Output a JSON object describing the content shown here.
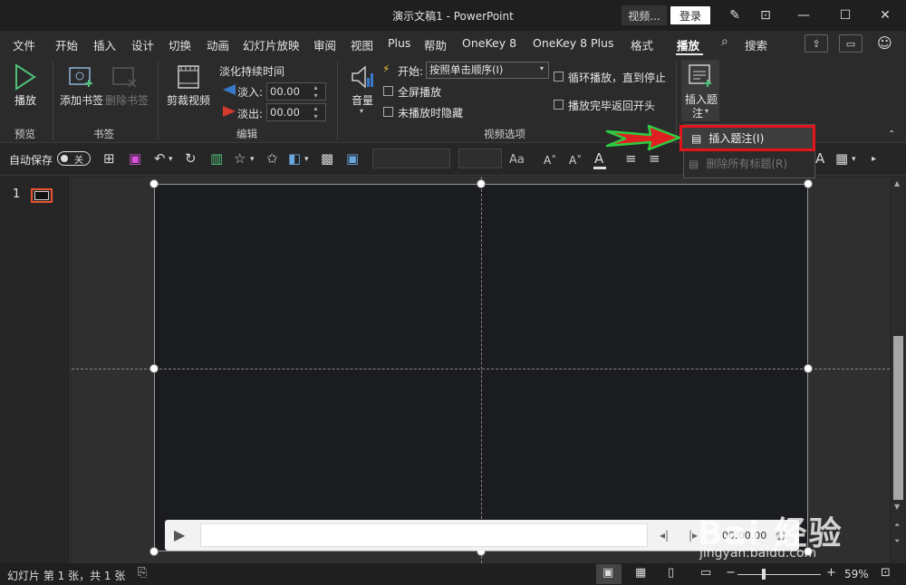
{
  "window": {
    "title": "演示文稿1  -  PowerPoint",
    "video_search": "视频...",
    "login": "登录"
  },
  "tabs": [
    "文件",
    "开始",
    "插入",
    "设计",
    "切换",
    "动画",
    "幻灯片放映",
    "审阅",
    "视图",
    "Plus",
    "帮助",
    "OneKey 8",
    "OneKey 8 Plus",
    "格式",
    "播放",
    "搜索"
  ],
  "active_tab": "播放",
  "ribbon": {
    "play_label": "播放",
    "add_bookmark": "添加书签",
    "remove_bookmark": "删除书签",
    "trim_video": "剪裁视频",
    "fade_duration": "淡化持续时间",
    "fade_in_label": "淡入:",
    "fade_in_value": "00.00",
    "fade_out_label": "淡出:",
    "fade_out_value": "00.00",
    "volume": "音量",
    "start_label": "开始:",
    "start_value": "按照单击顺序(I)",
    "fullscreen": "全屏播放",
    "hide_not_playing": "未播放时隐藏",
    "loop": "循环播放，直到停止",
    "rewind": "播放完毕返回开头",
    "insert_caption_line1": "插入题",
    "insert_caption_line2": "注",
    "groups": {
      "preview": "预览",
      "bookmarks": "书签",
      "editing": "编辑",
      "video_options": "视频选项"
    }
  },
  "qat": {
    "autosave_label": "自动保存",
    "autosave_state": "关"
  },
  "dropdown": {
    "insert_caption": "插入题注(I)",
    "remove_all_captions": "删除所有标题(R)"
  },
  "slide_panel": {
    "slide_number": "1"
  },
  "media": {
    "time": "00:00.00"
  },
  "status": {
    "text": "幻灯片 第 1 张，共 1 张",
    "zoom": "59%"
  },
  "watermark": {
    "brand": "Bai 经验",
    "url": "jingyan.baidu.com"
  },
  "colors": {
    "highlight_border": "#e3151a",
    "thumbnail_border": "#e8542d",
    "arrow_fill": "#e02020",
    "arrow_outline": "#2ecc40"
  }
}
